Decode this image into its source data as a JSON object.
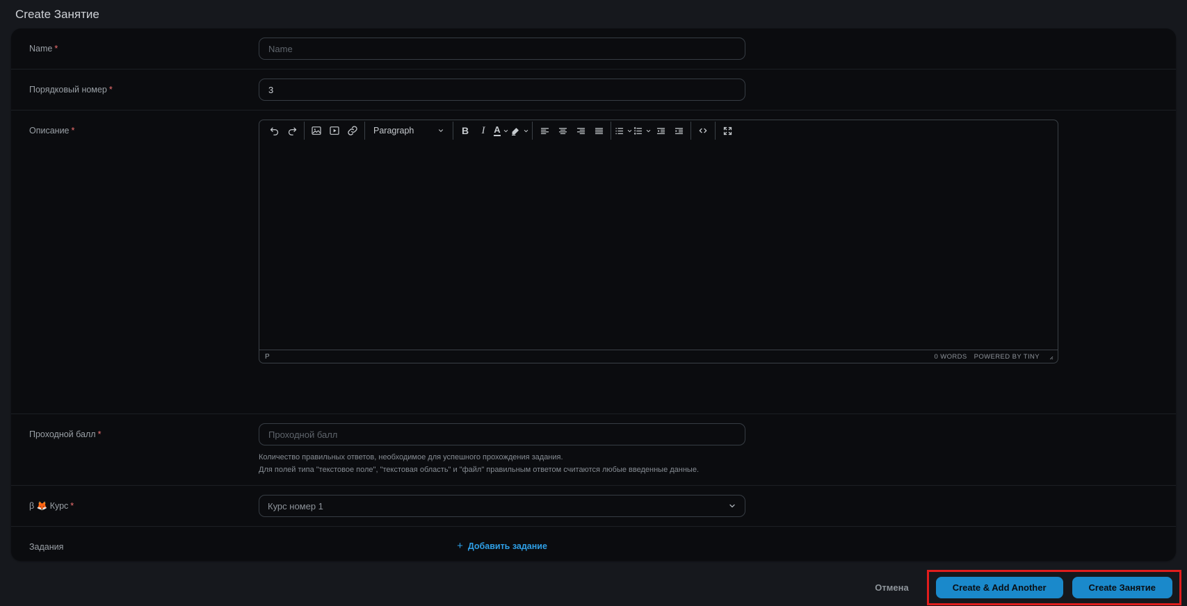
{
  "title": "Create Занятие",
  "form": {
    "name": {
      "label": "Name",
      "required": "*",
      "placeholder": "Name",
      "value": ""
    },
    "order": {
      "label": "Порядковый номер",
      "required": "*",
      "value": "3"
    },
    "description": {
      "label": "Описание",
      "required": "*"
    },
    "passing_score": {
      "label": "Проходной балл",
      "required": "*",
      "placeholder": "Проходной балл",
      "value": "",
      "help_line1": "Количество правильных ответов, необходимое для успешного прохождения задания.",
      "help_line2": "Для полей типа \"текстовое поле\", \"текстовая область\" и \"файл\" правильным ответом считаются любые введенные данные."
    },
    "course": {
      "label": "β 🦊 Курс",
      "required": "*",
      "selected": "Курс номер 1"
    },
    "tasks": {
      "label": "Задания",
      "add_plus": "+",
      "add_label": "Добавить задание"
    }
  },
  "editor": {
    "paragraph_label": "Paragraph",
    "bold_label": "B",
    "italic_label": "I",
    "textcolor_label": "A",
    "block_path": "P",
    "word_count": "0 WORDS",
    "branding": "POWERED BY TINY"
  },
  "footer": {
    "cancel": "Отмена",
    "create_another": "Create & Add Another",
    "create": "Create Занятие"
  },
  "colors": {
    "accent_blue": "#1a89cb",
    "link_blue": "#2e9fe6",
    "annotation_red": "#e11d1d",
    "required_red": "#ef7070"
  }
}
